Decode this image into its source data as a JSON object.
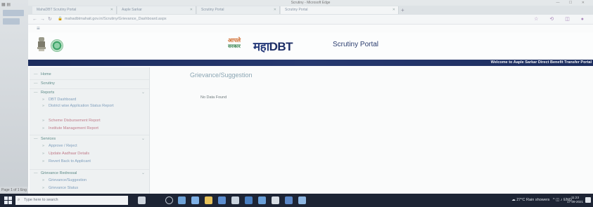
{
  "window": {
    "title": "Scrutiny - Microsoft Edge",
    "controls": "— ☐ ✕"
  },
  "tabs": [
    {
      "label": "MahaDBT Scrutiny Portal"
    },
    {
      "label": "Aaple Sarkar"
    },
    {
      "label": "Scrutiny Portal"
    },
    {
      "label": "Scrutiny Portal"
    }
  ],
  "address_bar": {
    "url": "mahadbtmahait.gov.in/Scrutiny/Grievance_Dashboard.aspx"
  },
  "header": {
    "aaple_line1": "आपले",
    "aaple_line2": "सरकार",
    "maha": "महा",
    "dbt": "DBT",
    "portal_name": "Scrutiny Portal"
  },
  "strip": {
    "welcome": "Welcome to Aaple Sarkar Direct Benefit Transfer Portal"
  },
  "sidebar": {
    "items": [
      {
        "label": "Home",
        "level": 0
      },
      {
        "label": "Scrutiny",
        "level": 0
      },
      {
        "label": "Reports",
        "level": 0,
        "expand": "⌄"
      },
      {
        "label": "DBT Dashboard",
        "level": 1
      },
      {
        "label": "District wise Application Status Report",
        "level": 1
      },
      {
        "label": "Scheme Disbursement Report",
        "level": 1
      },
      {
        "label": "Institute Management Report",
        "level": 1
      },
      {
        "label": "Services",
        "level": 0,
        "expand": "⌄"
      },
      {
        "label": "Approve / Reject",
        "level": 1
      },
      {
        "label": "Update Aadhaar Details",
        "level": 1
      },
      {
        "label": "Revert Back to Applicant",
        "level": 1
      },
      {
        "label": "Grievance Redressal",
        "level": 0,
        "expand": "⌄"
      },
      {
        "label": "Grievance/Suggestion",
        "level": 1
      },
      {
        "label": "Grievance Status",
        "level": 1
      }
    ]
  },
  "main": {
    "title": "Grievance/Suggestion",
    "message": "No Data Found"
  },
  "taskbar": {
    "search_placeholder": "Type here to search",
    "weather": "27°C  Rain showers",
    "time": "11:23",
    "date": "17-09-2021"
  },
  "outer": {
    "status_text": "Page 1 of 1  Eng"
  },
  "colors": {
    "strip": "#1c2d5e",
    "maha_blue": "#263a7a",
    "aaple_orange": "#d06a2c",
    "aaple_green": "#2e7d46",
    "taskbar": "#1d2434"
  }
}
